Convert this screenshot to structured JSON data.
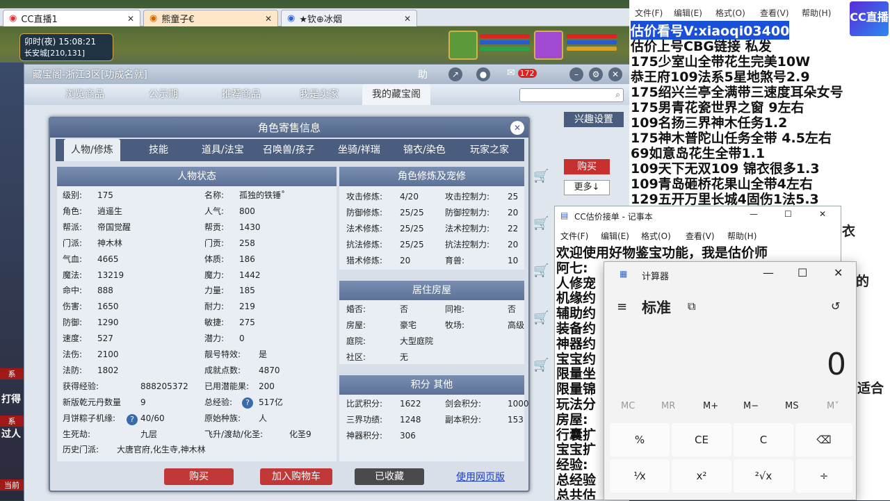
{
  "browser": {
    "tabs": [
      {
        "label": "CC直播1",
        "close": "✕"
      },
      {
        "label": "熊童子€",
        "close": "✕"
      },
      {
        "label": "★钦⊕冰烟",
        "close": "✕"
      }
    ]
  },
  "game": {
    "time": "卯时(夜)",
    "clock": "15:08:21",
    "location": "长安城[210,131]",
    "left_labels": [
      "系",
      "打得",
      "系",
      "过人",
      "当前"
    ]
  },
  "cbg": {
    "title": "藏宝阁-浙江3区[功成名就]",
    "help": "助",
    "cart_count": "172",
    "nav": [
      "浏览商品",
      "公示期",
      "推荐商品",
      "我是卖家",
      "我的藏宝阁"
    ],
    "interest_btn": "兴趣设置",
    "buy_btn": "购买",
    "more_btn": "更多↓"
  },
  "dialog": {
    "title": "角色寄售信息",
    "close": "✕",
    "tabs": [
      "人物/修炼",
      "技能",
      "道具/法宝",
      "召唤兽/孩子",
      "坐骑/祥瑞",
      "锦衣/染色",
      "玩家之家"
    ],
    "status_head": "人物状态",
    "status_left": [
      [
        "级别:",
        "175"
      ],
      [
        "角色:",
        "逍遥生"
      ],
      [
        "帮派:",
        "帝国觉醒"
      ],
      [
        "门派:",
        "神木林"
      ],
      [
        "气血:",
        "4665"
      ],
      [
        "魔法:",
        "13219"
      ],
      [
        "命中:",
        "888"
      ],
      [
        "伤害:",
        "1650"
      ],
      [
        "防御:",
        "1290"
      ],
      [
        "速度:",
        "527"
      ],
      [
        "法伤:",
        "2100"
      ],
      [
        "法防:",
        "1802"
      ],
      [
        "获得经验:",
        "888205372"
      ],
      [
        "新版乾元丹数量",
        "9"
      ],
      [
        "月饼粽子机缘:",
        "40/60"
      ],
      [
        "生死劫:",
        "九层"
      ]
    ],
    "status_right": [
      [
        "名称:",
        "孤独的铁锤˚"
      ],
      [
        "人气:",
        "800"
      ],
      [
        "帮贡:",
        "1430"
      ],
      [
        "门贡:",
        "258"
      ],
      [
        "体质:",
        "186"
      ],
      [
        "魔力:",
        "1442"
      ],
      [
        "力量:",
        "185"
      ],
      [
        "耐力:",
        "219"
      ],
      [
        "敏捷:",
        "275"
      ],
      [
        "潜力:",
        "0"
      ],
      [
        "靓号特效:",
        "是"
      ],
      [
        "成就点数:",
        "4870"
      ],
      [
        "已用潜能果:",
        "200"
      ],
      [
        "总经验:",
        "517亿"
      ],
      [
        "原始种族:",
        "人"
      ],
      [
        "飞升/渡劫/化圣:",
        "化圣9"
      ]
    ],
    "history_label": "历史门派:",
    "history_value": "大唐官府,化生寺,神木林",
    "cultivation_head": "角色修炼及宠修",
    "cultivation": [
      [
        "攻击修炼:",
        "4/20",
        "攻击控制力:",
        "25"
      ],
      [
        "防御修炼:",
        "25/25",
        "防御控制力:",
        "20"
      ],
      [
        "法术修炼:",
        "25/25",
        "法术控制力:",
        "22"
      ],
      [
        "抗法修炼:",
        "25/25",
        "抗法控制力:",
        "20"
      ],
      [
        "猎术修炼:",
        "20",
        "育兽:",
        "10"
      ]
    ],
    "house_head": "居住房屋",
    "house": [
      [
        "婚否:",
        "否",
        "同袍:",
        "否"
      ],
      [
        "房屋:",
        "豪宅",
        "牧场:",
        "高级"
      ],
      [
        "庭院:",
        "大型庭院",
        "",
        ""
      ],
      [
        "社区:",
        "无",
        "",
        ""
      ]
    ],
    "score_head": "积分 其他",
    "score": [
      [
        "比武积分:",
        "1622",
        "剑会积分:",
        "1000"
      ],
      [
        "三界功绩:",
        "1248",
        "副本积分:",
        "153"
      ],
      [
        "神器积分:",
        "306",
        "",
        ""
      ]
    ],
    "buttons": {
      "buy": "购买",
      "add_cart": "加入购物车",
      "collected": "已收藏",
      "web": "使用网页版"
    }
  },
  "notepad1": {
    "menu": [
      "文件(F)",
      "编辑(E)",
      "格式(O)",
      "查看(V)",
      "帮助(H)"
    ],
    "lines": [
      "估价看号V:xiaoqi03400",
      "估价上号CBG链接 私发",
      "175少室山全带花生完美10W",
      "恭王府109法系5星地煞号2.9",
      "175绍兴兰亭全满带三速度耳朵女号",
      "175男青花瓷世界之窗  9左右",
      "109名扬三界神木任务1.2",
      "175神木普陀山任务全带 4.5左右",
      "69如意岛花生全带1.1",
      "109天下无双109  锦衣很多1.3",
      "109青岛砸桥花果山全带4左右",
      "129五开万里长城4固伤1法5.3"
    ],
    "logo": "CC直播",
    "partial": [
      "衣",
      "的",
      "适合"
    ]
  },
  "notepad2": {
    "title": "CC估价接单 - 记事本",
    "menu": [
      "文件(F)",
      "编辑(E)",
      "格式(O)",
      "查看(V)",
      "帮助(H)"
    ],
    "lines": [
      "欢迎使用好物鉴宝功能，我是估价师",
      "阿七:",
      "人修宠",
      "机缘约",
      "辅助约",
      "装备约",
      "神器约",
      "宝宝约",
      "限量坐",
      "限量锦",
      "玩法分",
      "房屋:",
      "行囊扩",
      "宝宝扩",
      "经验:",
      "总经验",
      "总共估"
    ]
  },
  "calculator": {
    "title": "计算器",
    "mode": "标准",
    "display": "0",
    "memory": [
      "MC",
      "MR",
      "M+",
      "M−",
      "MS",
      "M˅"
    ],
    "keys_row1": [
      "%",
      "CE",
      "C",
      "⌫"
    ],
    "keys_row2": [
      "¹⁄x",
      "x²",
      "²√x",
      "÷"
    ]
  }
}
